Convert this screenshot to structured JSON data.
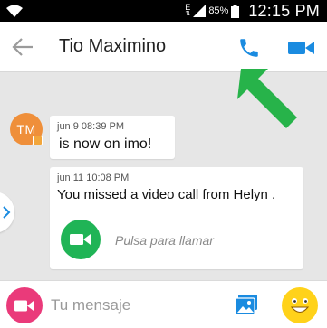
{
  "status_bar": {
    "network_label": "E",
    "battery_percent": "85%",
    "time": "12:15 PM"
  },
  "header": {
    "contact_name": "Tio Maximino",
    "icons": [
      "back-arrow-icon",
      "phone-icon",
      "video-camera-icon"
    ]
  },
  "contact": {
    "initials": "TM"
  },
  "messages": [
    {
      "timestamp": "jun 9 08:39 PM",
      "text": "is now on imo!"
    },
    {
      "timestamp": "jun 11 10:08 PM",
      "text": "You missed a video call from Helyn .",
      "action_label": "Pulsa para llamar"
    }
  ],
  "composer": {
    "placeholder": "Tu mensaje",
    "icons": [
      "camera-icon",
      "gallery-icon",
      "emoji-icon"
    ]
  },
  "colors": {
    "accent_blue": "#1a8be0",
    "call_green": "#20b456",
    "camera_pink": "#ea3a7a",
    "emoji_yellow": "#ffd21a",
    "avatar_orange": "#ef8f3a",
    "annotation_arrow_green": "#27b34a"
  }
}
